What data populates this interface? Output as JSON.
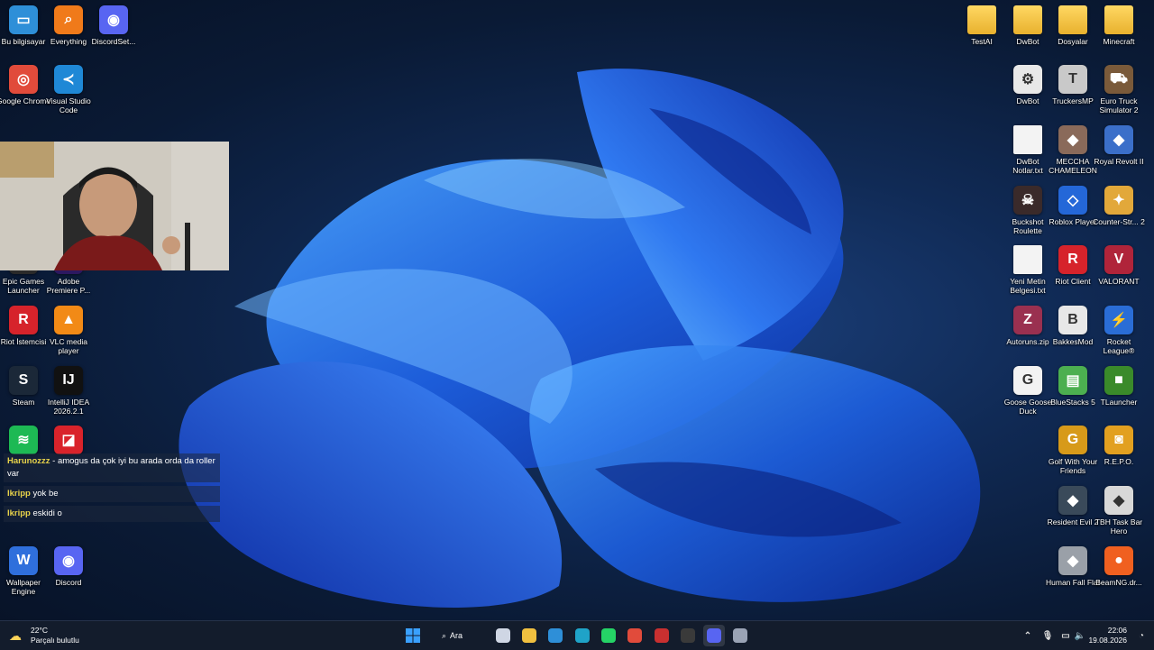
{
  "desktop": {
    "left_icons": [
      {
        "label": "Bu bilgisayar",
        "icon": "computer-icon",
        "color": "#2e8fd8"
      },
      {
        "label": "Everything",
        "icon": "search-icon",
        "color": "#f07a1a"
      },
      {
        "label": "DiscordSet...",
        "icon": "discord-icon",
        "color": "#5865f2"
      },
      {
        "label": "Google Chrome",
        "icon": "chrome-icon",
        "color": "#e14b3b"
      },
      {
        "label": "Visual Studio Code",
        "icon": "vscode-icon",
        "color": "#1f88d6"
      },
      {
        "label": "Epic Games Launcher",
        "icon": "epic-icon",
        "color": "#2a2a2a"
      },
      {
        "label": "Adobe Premiere P...",
        "icon": "premiere-icon",
        "color": "#2c1860"
      },
      {
        "label": "Riot İstemcisi",
        "icon": "riot-icon",
        "color": "#d6232b"
      },
      {
        "label": "VLC media player",
        "icon": "vlc-icon",
        "color": "#f28a16"
      },
      {
        "label": "Steam",
        "icon": "steam-icon",
        "color": "#1b2838"
      },
      {
        "label": "IntelliJ IDEA 2026.2.1",
        "icon": "intellij-icon",
        "color": "#111111"
      },
      {
        "label": "",
        "icon": "spotify-icon",
        "color": "#1db954"
      },
      {
        "label": "",
        "icon": "red-app-icon",
        "color": "#d9232b"
      },
      {
        "label": "Wallpaper Engine",
        "icon": "wallpaper-engine-icon",
        "color": "#2f6fdc"
      },
      {
        "label": "Discord",
        "icon": "discord-icon",
        "color": "#5865f2"
      }
    ],
    "right_icons": [
      {
        "label": "TestAI",
        "icon": "folder-icon",
        "color": "#f0c040"
      },
      {
        "label": "DwBot",
        "icon": "folder-icon",
        "color": "#f0c040"
      },
      {
        "label": "Dosyalar",
        "icon": "folder-icon",
        "color": "#f0c040"
      },
      {
        "label": "Minecraft",
        "icon": "folder-icon",
        "color": "#f0c040"
      },
      {
        "label": "DwBot",
        "icon": "settings-file-icon",
        "color": "#e8e8e8"
      },
      {
        "label": "TruckersMP",
        "icon": "truckersmp-icon",
        "color": "#c9c9c9"
      },
      {
        "label": "Euro Truck Simulator 2",
        "icon": "truck-icon",
        "color": "#7a5a3a"
      },
      {
        "label": "DwBot Notlar.txt",
        "icon": "text-file-icon",
        "color": "#f3f3f3"
      },
      {
        "label": "MECCHA CHAMELEON",
        "icon": "game-icon",
        "color": "#8a6a5a"
      },
      {
        "label": "Royal Revolt II",
        "icon": "game-icon",
        "color": "#3b6fc9"
      },
      {
        "label": "Buckshot Roulette",
        "icon": "skull-icon",
        "color": "#3a2a2a"
      },
      {
        "label": "Roblox Player",
        "icon": "roblox-icon",
        "color": "#2467d8"
      },
      {
        "label": "Counter-Str... 2",
        "icon": "cs2-icon",
        "color": "#e2a83a"
      },
      {
        "label": "Yeni Metin Belgesi.txt",
        "icon": "text-file-icon",
        "color": "#f3f3f3"
      },
      {
        "label": "Riot Client",
        "icon": "riot-icon",
        "color": "#d6232b"
      },
      {
        "label": "VALORANT",
        "icon": "valorant-icon",
        "color": "#b0243a"
      },
      {
        "label": "Autoruns.zip",
        "icon": "zip-icon",
        "color": "#9a3050"
      },
      {
        "label": "BakkesMod",
        "icon": "bakkesmod-icon",
        "color": "#e8e8e8"
      },
      {
        "label": "Rocket League®",
        "icon": "rocket-league-icon",
        "color": "#2a6dd6"
      },
      {
        "label": "Goose Goose Duck",
        "icon": "goose-icon",
        "color": "#f2f2f2"
      },
      {
        "label": "BlueStacks 5",
        "icon": "bluestacks-icon",
        "color": "#4caf50"
      },
      {
        "label": "TLauncher",
        "icon": "tlauncher-icon",
        "color": "#3a8a2a"
      },
      {
        "label": "Golf With Your Friends",
        "icon": "golf-icon",
        "color": "#d79a1a"
      },
      {
        "label": "R.E.P.O.",
        "icon": "repo-icon",
        "color": "#e2a020"
      },
      {
        "label": "Resident Evil 2",
        "icon": "game-icon",
        "color": "#3a4a5a"
      },
      {
        "label": "TBH Task Bar Hero",
        "icon": "game-icon",
        "color": "#d8d8d8"
      },
      {
        "label": "Human Fall Flat",
        "icon": "game-icon",
        "color": "#9aa0a8"
      },
      {
        "label": "BeamNG.dr...",
        "icon": "beamng-icon",
        "color": "#f06020"
      }
    ]
  },
  "chat": [
    {
      "user": "Harunozzz",
      "text": "- amogus da çok iyi bu arada orda da roller var"
    },
    {
      "user": "Ikripp",
      "text": "yok be"
    },
    {
      "user": "Ikripp",
      "text": "eskidi o"
    }
  ],
  "taskbar": {
    "weather_temp": "22°C",
    "weather_desc": "Parçalı bulutlu",
    "search_label": "Ara",
    "apps": [
      {
        "icon": "start-icon",
        "color": "#3aa0ff"
      },
      {
        "icon": "task-view-icon",
        "color": "#cfd6e4"
      },
      {
        "icon": "file-explorer-icon",
        "color": "#f0c040"
      },
      {
        "icon": "store-icon",
        "color": "#2e8fd8"
      },
      {
        "icon": "edge-icon",
        "color": "#1fa3c8"
      },
      {
        "icon": "whatsapp-icon",
        "color": "#25d366"
      },
      {
        "icon": "chrome-icon",
        "color": "#e14b3b"
      },
      {
        "icon": "antivirus-icon",
        "color": "#c83030"
      },
      {
        "icon": "terminal-icon",
        "color": "#3a3a3a"
      },
      {
        "icon": "discord-icon",
        "color": "#5865f2"
      },
      {
        "icon": "settings-icon",
        "color": "#9aa3b5"
      }
    ],
    "time": "22:06",
    "date": "19.08.2026"
  }
}
